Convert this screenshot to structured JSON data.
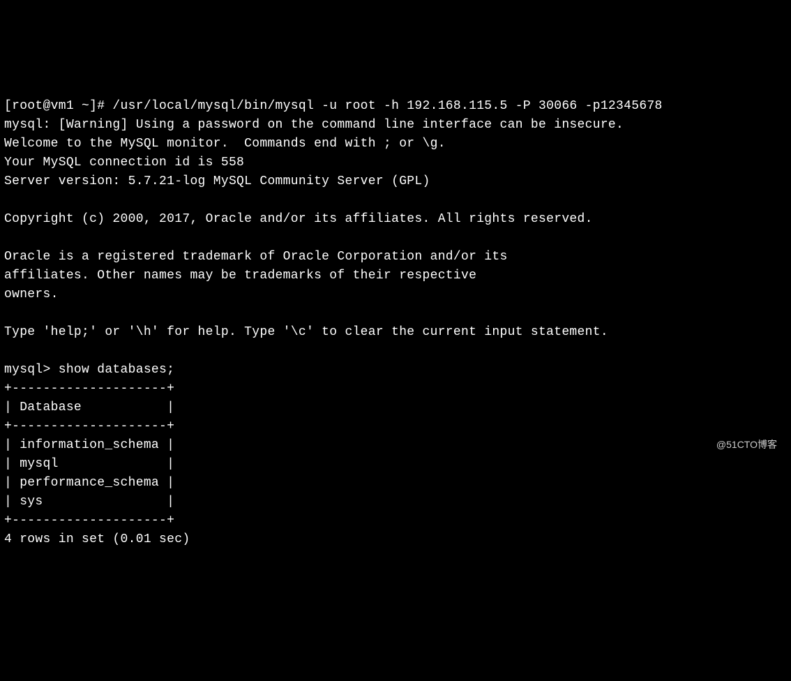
{
  "terminal": {
    "prompt_line": "[root@vm1 ~]# /usr/local/mysql/bin/mysql -u root -h 192.168.115.5 -P 30066 -p12345678",
    "warning_line": "mysql: [Warning] Using a password on the command line interface can be insecure.",
    "welcome_line": "Welcome to the MySQL monitor.  Commands end with ; or \\g.",
    "connection_line": "Your MySQL connection id is 558",
    "server_version_line": "Server version: 5.7.21-log MySQL Community Server (GPL)",
    "blank1": "",
    "copyright_line": "Copyright (c) 2000, 2017, Oracle and/or its affiliates. All rights reserved.",
    "blank2": "",
    "trademark_line1": "Oracle is a registered trademark of Oracle Corporation and/or its",
    "trademark_line2": "affiliates. Other names may be trademarks of their respective",
    "trademark_line3": "owners.",
    "blank3": "",
    "help_line": "Type 'help;' or '\\h' for help. Type '\\c' to clear the current input statement.",
    "blank4": "",
    "query_line": "mysql> show databases;",
    "table_border_top": "+--------------------+",
    "table_header": "| Database           |",
    "table_border_mid": "+--------------------+",
    "row1": "| information_schema |",
    "row2": "| mysql              |",
    "row3": "| performance_schema |",
    "row4": "| sys                |",
    "table_border_bot": "+--------------------+",
    "result_line": "4 rows in set (0.01 sec)"
  },
  "watermark": "@51CTO博客"
}
